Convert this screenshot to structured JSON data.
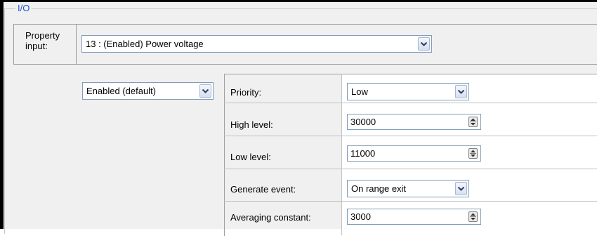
{
  "io_group": {
    "title": "I/O"
  },
  "property": {
    "label": "Property input:",
    "selected": "13 : (Enabled) Power voltage"
  },
  "mode": {
    "selected": "Enabled (default)"
  },
  "settings": [
    {
      "label": "Priority:",
      "value": "Low",
      "control": "dropdown"
    },
    {
      "label": "High level:",
      "value": "30000",
      "control": "spinner"
    },
    {
      "label": "Low level:",
      "value": "11000",
      "control": "spinner"
    },
    {
      "label": "Generate event:",
      "value": "On range exit",
      "control": "dropdown"
    },
    {
      "label": "Averaging constant:",
      "value": "3000",
      "control": "spinner"
    }
  ],
  "colors": {
    "group_title": "#1e53d0",
    "panel_bg": "#f0f0f0",
    "control_border": "#7f9db9"
  },
  "icons": {
    "dropdown_button": "chevron-down-icon",
    "spinner_button": "up-down-arrows-icon"
  }
}
